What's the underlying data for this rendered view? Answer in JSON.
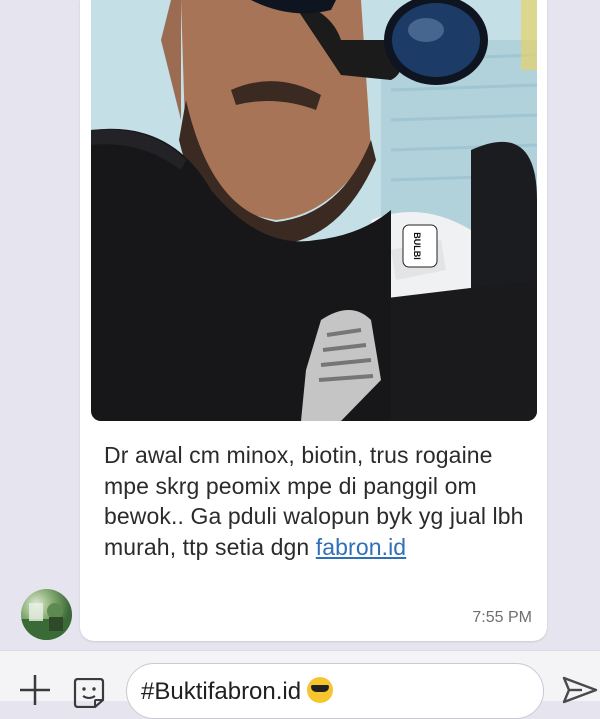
{
  "message": {
    "text_before_link": "Dr awal cm minox, biotin, trus rogaine mpe skrg peomix mpe di panggil om bewok.. Ga pduli walopun byk yg jual lbh murah, ttp setia dgn ",
    "link_text": "fabron.id",
    "timestamp": "7:55 PM",
    "photo_badge_text": "BULBI"
  },
  "composer": {
    "input_value": "#Buktifabron.id",
    "input_emoji": "sunglasses-emoji",
    "plus_icon": "plus-icon",
    "sticker_icon": "sticker-icon",
    "send_icon": "send-icon"
  },
  "avatar": {
    "icon": "user-avatar"
  },
  "colors": {
    "chat_background": "#e6e5ef",
    "bubble": "#ffffff",
    "link": "#2f6fb8",
    "composer": "#f4f4f7"
  }
}
